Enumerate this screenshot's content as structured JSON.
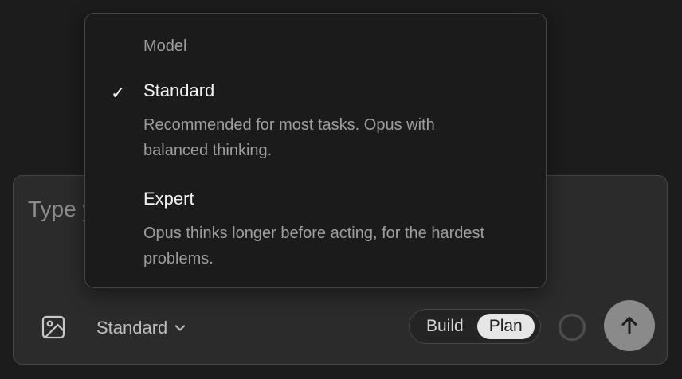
{
  "composer": {
    "placeholder": "Type your message...",
    "model_label": "Standard",
    "mode_options": [
      "Build",
      "Plan"
    ],
    "active_mode": "Plan",
    "icons": {
      "attach": "image-icon",
      "dropdown": "chevron-down-icon",
      "progress": "progress-ring-icon",
      "send": "arrow-up-icon"
    }
  },
  "model_menu": {
    "heading": "Model",
    "selected_mark": "✓",
    "options": [
      {
        "title": "Standard",
        "description": "Recommended for most tasks. Opus with balanced thinking.",
        "selected": true
      },
      {
        "title": "Expert",
        "description": "Opus thinks longer before acting, for the hardest problems.",
        "selected": false
      }
    ]
  },
  "colors": {
    "background": "#1c1c1c",
    "panel": "#2b2b2b",
    "active_toggle": "#e6e6e6",
    "send_button": "#8a8a8a"
  }
}
